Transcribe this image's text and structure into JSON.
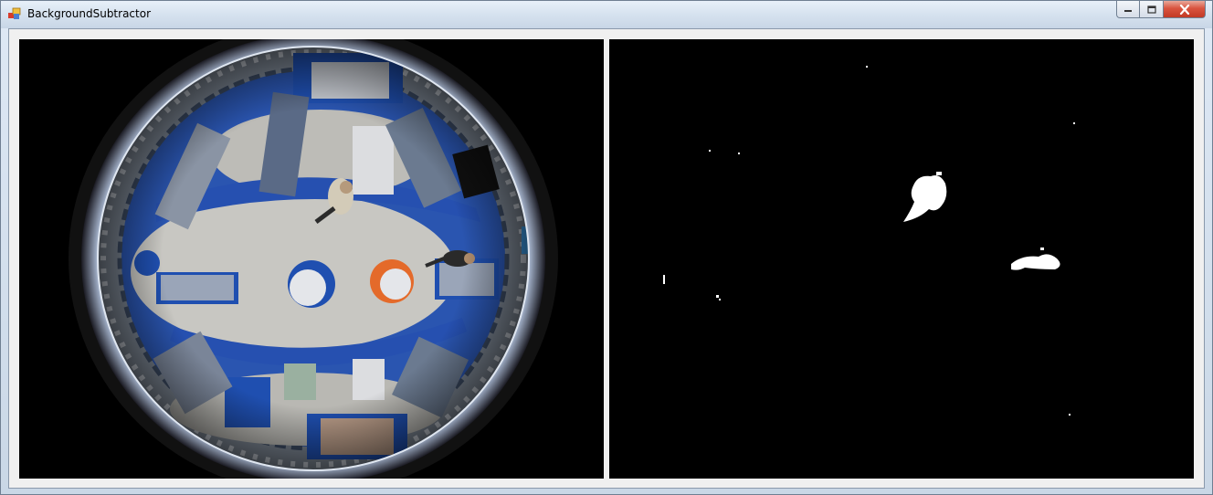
{
  "window": {
    "title": "BackgroundSubtractor"
  },
  "icons": {
    "app": "app-icon",
    "minimize": "minimize-icon",
    "maximize": "maximize-icon",
    "close": "close-icon"
  },
  "views": {
    "original": "camera-frame",
    "foreground_mask": "foreground-mask"
  }
}
